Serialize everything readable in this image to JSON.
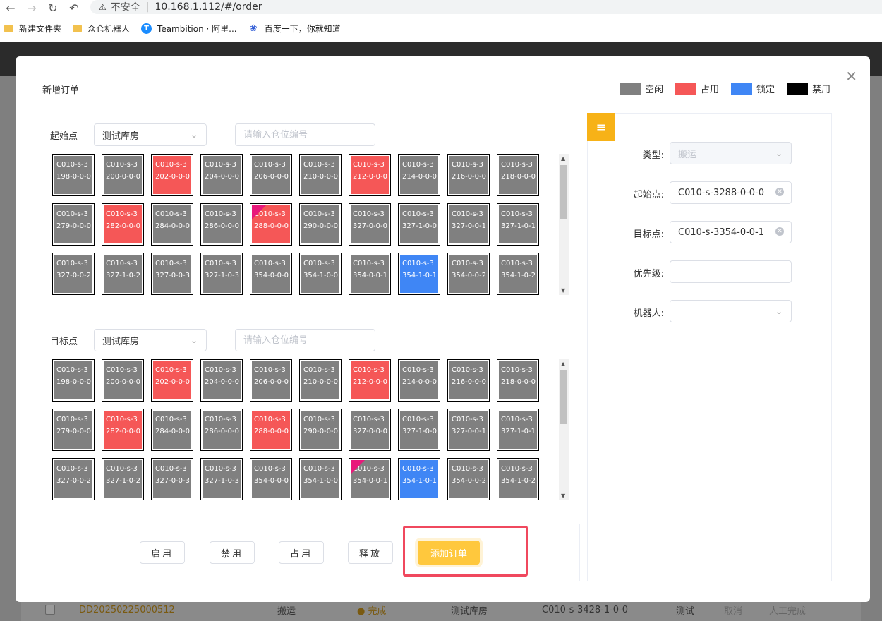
{
  "browser": {
    "url": "10.168.1.112/#/order",
    "insecure_label": "不安全",
    "bookmarks": [
      {
        "label": "新建文件夹",
        "icon": "folder-icon"
      },
      {
        "label": "众仓机器人",
        "icon": "folder-icon"
      },
      {
        "label": "Teambition · 阿里...",
        "icon": "teambition-icon"
      },
      {
        "label": "百度一下，你就知道",
        "icon": "baidu-paw-icon"
      }
    ]
  },
  "background_row": {
    "order_id": "DD20250225000512",
    "type": "搬运",
    "status": "● 完成",
    "warehouse": "测试库房",
    "location": "C010-s-3428-1-0-0",
    "robot": "测试",
    "action_cancel": "取消",
    "action_manual": "人工完成"
  },
  "modal": {
    "title": "新增订单",
    "legend": [
      {
        "label": "空闲",
        "color": "#808080"
      },
      {
        "label": "占用",
        "color": "#f55757"
      },
      {
        "label": "锁定",
        "color": "#3f86f5"
      },
      {
        "label": "禁用",
        "color": "#000000"
      }
    ],
    "start": {
      "label": "起始点",
      "warehouse": "测试库房",
      "search_placeholder": "请输入仓位编号",
      "rows": [
        [
          {
            "t": "C010-s-3198-0-0-0",
            "s": "idle"
          },
          {
            "t": "C010-s-3200-0-0-0",
            "s": "idle"
          },
          {
            "t": "C010-s-3202-0-0-0",
            "s": "occupied"
          },
          {
            "t": "C010-s-3204-0-0-0",
            "s": "idle"
          },
          {
            "t": "C010-s-3206-0-0-0",
            "s": "idle"
          },
          {
            "t": "C010-s-3210-0-0-0",
            "s": "idle"
          },
          {
            "t": "C010-s-3212-0-0-0",
            "s": "occupied"
          },
          {
            "t": "C010-s-3214-0-0-0",
            "s": "idle"
          },
          {
            "t": "C010-s-3216-0-0-0",
            "s": "idle"
          },
          {
            "t": "C010-s-3218-0-0-0",
            "s": "idle"
          }
        ],
        [
          {
            "t": "C010-s-3279-0-0-0",
            "s": "idle"
          },
          {
            "t": "C010-s-3282-0-0-0",
            "s": "occupied"
          },
          {
            "t": "C010-s-3284-0-0-0",
            "s": "idle"
          },
          {
            "t": "C010-s-3286-0-0-0",
            "s": "idle"
          },
          {
            "t": "C010-s-3288-0-0-0",
            "s": "occupied",
            "sel": true
          },
          {
            "t": "C010-s-3290-0-0-0",
            "s": "idle"
          },
          {
            "t": "C010-s-3327-0-0-0",
            "s": "idle"
          },
          {
            "t": "C010-s-3327-1-0-0",
            "s": "idle"
          },
          {
            "t": "C010-s-3327-0-0-1",
            "s": "idle"
          },
          {
            "t": "C010-s-3327-1-0-1",
            "s": "idle"
          }
        ],
        [
          {
            "t": "C010-s-3327-0-0-2",
            "s": "idle"
          },
          {
            "t": "C010-s-3327-1-0-2",
            "s": "idle"
          },
          {
            "t": "C010-s-3327-0-0-3",
            "s": "idle"
          },
          {
            "t": "C010-s-3327-1-0-3",
            "s": "idle"
          },
          {
            "t": "C010-s-3354-0-0-0",
            "s": "idle"
          },
          {
            "t": "C010-s-3354-1-0-0",
            "s": "idle"
          },
          {
            "t": "C010-s-3354-0-0-1",
            "s": "idle"
          },
          {
            "t": "C010-s-3354-1-0-1",
            "s": "locked"
          },
          {
            "t": "C010-s-3354-0-0-2",
            "s": "idle"
          },
          {
            "t": "C010-s-3354-1-0-2",
            "s": "idle"
          }
        ]
      ]
    },
    "target": {
      "label": "目标点",
      "warehouse": "测试库房",
      "search_placeholder": "请输入仓位编号",
      "rows": [
        [
          {
            "t": "C010-s-3198-0-0-0",
            "s": "idle"
          },
          {
            "t": "C010-s-3200-0-0-0",
            "s": "idle"
          },
          {
            "t": "C010-s-3202-0-0-0",
            "s": "occupied"
          },
          {
            "t": "C010-s-3204-0-0-0",
            "s": "idle"
          },
          {
            "t": "C010-s-3206-0-0-0",
            "s": "idle"
          },
          {
            "t": "C010-s-3210-0-0-0",
            "s": "idle"
          },
          {
            "t": "C010-s-3212-0-0-0",
            "s": "occupied"
          },
          {
            "t": "C010-s-3214-0-0-0",
            "s": "idle"
          },
          {
            "t": "C010-s-3216-0-0-0",
            "s": "idle"
          },
          {
            "t": "C010-s-3218-0-0-0",
            "s": "idle"
          }
        ],
        [
          {
            "t": "C010-s-3279-0-0-0",
            "s": "idle"
          },
          {
            "t": "C010-s-3282-0-0-0",
            "s": "occupied"
          },
          {
            "t": "C010-s-3284-0-0-0",
            "s": "idle"
          },
          {
            "t": "C010-s-3286-0-0-0",
            "s": "idle"
          },
          {
            "t": "C010-s-3288-0-0-0",
            "s": "occupied"
          },
          {
            "t": "C010-s-3290-0-0-0",
            "s": "idle"
          },
          {
            "t": "C010-s-3327-0-0-0",
            "s": "idle"
          },
          {
            "t": "C010-s-3327-1-0-0",
            "s": "idle"
          },
          {
            "t": "C010-s-3327-0-0-1",
            "s": "idle"
          },
          {
            "t": "C010-s-3327-1-0-1",
            "s": "idle"
          }
        ],
        [
          {
            "t": "C010-s-3327-0-0-2",
            "s": "idle"
          },
          {
            "t": "C010-s-3327-1-0-2",
            "s": "idle"
          },
          {
            "t": "C010-s-3327-0-0-3",
            "s": "idle"
          },
          {
            "t": "C010-s-3327-1-0-3",
            "s": "idle"
          },
          {
            "t": "C010-s-3354-0-0-0",
            "s": "idle"
          },
          {
            "t": "C010-s-3354-1-0-0",
            "s": "idle"
          },
          {
            "t": "C010-s-3354-0-0-1",
            "s": "idle",
            "sel": true
          },
          {
            "t": "C010-s-3354-1-0-1",
            "s": "locked"
          },
          {
            "t": "C010-s-3354-0-0-2",
            "s": "idle"
          },
          {
            "t": "C010-s-3354-1-0-2",
            "s": "idle"
          }
        ]
      ]
    },
    "buttons": {
      "enable": "启用",
      "disable": "禁用",
      "occupy": "占用",
      "release": "释放",
      "add_order": "添加订单"
    },
    "form": {
      "type_label": "类型:",
      "type_value": "搬运",
      "start_label": "起始点:",
      "start_value": "C010-s-3288-0-0-0",
      "target_label": "目标点:",
      "target_value": "C010-s-3354-0-0-1",
      "priority_label": "优先级:",
      "priority_value": "",
      "robot_label": "机器人:",
      "robot_value": ""
    }
  }
}
